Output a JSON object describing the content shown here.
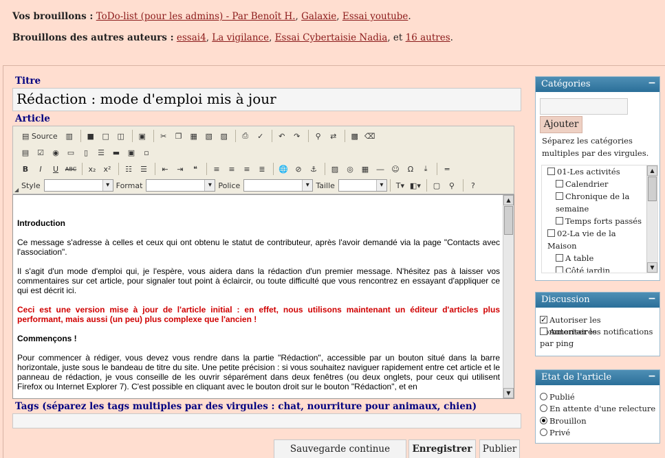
{
  "drafts": {
    "mine_label": "Vos brouillons :",
    "mine": [
      "ToDo-list (pour les admins) - Par Benoît H.",
      "Galaxie",
      "Essai youtube"
    ],
    "others_label": "Brouillons des autres auteurs :",
    "others": [
      "essai4",
      "La vigilance",
      "Essai Cybertaisie Nadia"
    ],
    "others_sep": "et",
    "others_more": "16 autres"
  },
  "title": {
    "label": "Titre",
    "value": "Rédaction : mode d'emploi mis à jour"
  },
  "article": {
    "label": "Article",
    "toolbar": {
      "source_label": "Source",
      "style_label": "Style",
      "format_label": "Format",
      "font_label": "Police",
      "size_label": "Taille"
    },
    "content": {
      "h1": "Introduction",
      "p1": "Ce message s'adresse à celles et ceux qui ont obtenu le statut de contributeur, après l'avoir demandé via la page \"Contacts avec l'association\".",
      "p2": "Il s'agit d'un mode d'emploi qui, je l'espère, vous aidera dans la rédaction d'un premier message. N'hésitez pas à laisser vos commentaires sur cet article, pour signaler tout point à éclaircir, ou toute difficulté que vous rencontrez en essayant d'appliquer ce qui est décrit ici.",
      "p3": "Ceci est une version mise à jour de l'article initial : en effet, nous utilisons maintenant un éditeur d'articles plus performant, mais aussi (un peu) plus complexe que l'ancien !",
      "h2": "Commençons !",
      "p4": "Pour commencer à rédiger, vous devez vous rendre dans la partie \"Rédaction\", accessible par un bouton situé dans la barre horizontale, juste sous le bandeau de titre du site. Une petite précision : si vous souhaitez naviguer rapidement entre cet article et le panneau de rédaction, je vous conseille de les ouvrir séparément dans deux fenêtres (ou deux onglets, pour ceux qui utilisent Firefox ou Internet Explorer 7). C'est possible en cliquant avec le bouton droit sur le bouton \"Rédaction\", et en"
    }
  },
  "tags": {
    "label": "Tags (séparez les tags multiples par des virgules : chat, nourriture pour animaux, chien)"
  },
  "actions": {
    "autosave": "Sauvegarde continue",
    "save": "Enregistrer",
    "publish": "Publier"
  },
  "categories": {
    "title": "Catégories",
    "toggle": "−",
    "add": "Ajouter",
    "help": "Séparez les catégories multiples par des virgules.",
    "items": [
      {
        "label": "01-Les activités",
        "level": 1
      },
      {
        "label": "Calendrier",
        "level": 2
      },
      {
        "label": "Chronique de la semaine",
        "level": 2
      },
      {
        "label": "Temps forts passés",
        "level": 2
      },
      {
        "label": "02-La vie de la Maison",
        "level": 1
      },
      {
        "label": "A table",
        "level": 2
      },
      {
        "label": "Côté jardin",
        "level": 2
      }
    ]
  },
  "discussion": {
    "title": "Discussion",
    "toggle": "−",
    "comments": "Autoriser les commentaires",
    "pings": "Autoriser les notifications par ping"
  },
  "status": {
    "title": "Etat de l'article",
    "toggle": "−",
    "options": [
      "Publié",
      "En attente d'une relecture",
      "Brouillon",
      "Privé"
    ],
    "selected": "Brouillon"
  }
}
